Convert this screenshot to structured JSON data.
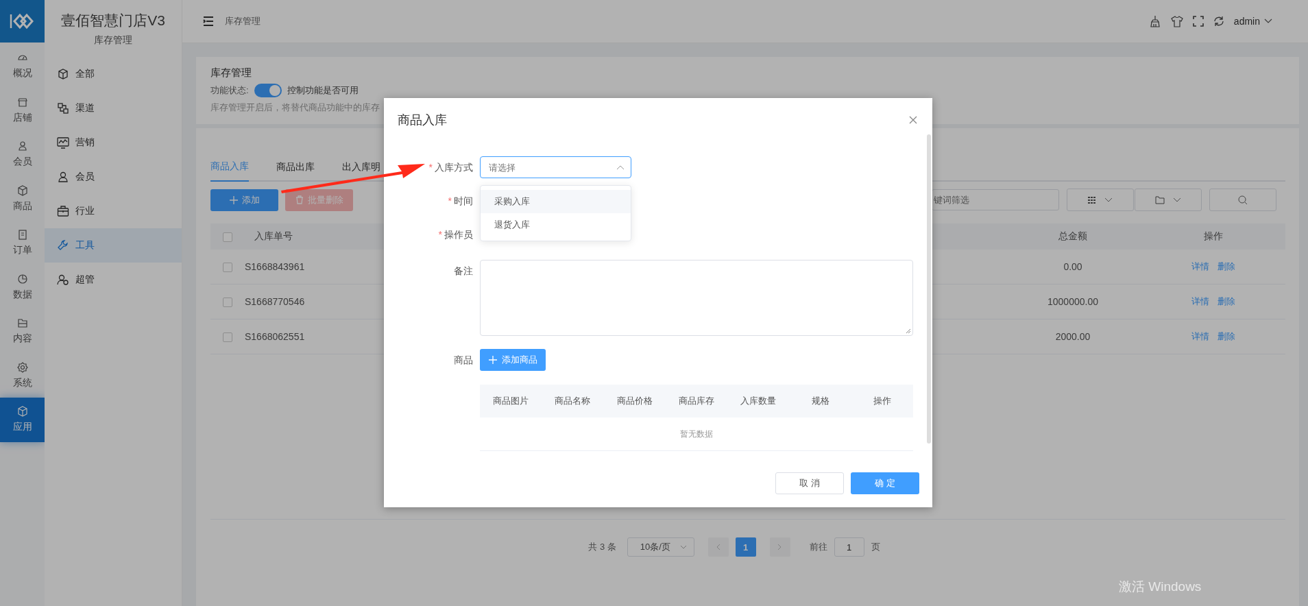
{
  "rail": {
    "items": [
      {
        "label": "概况",
        "selected": false
      },
      {
        "label": "店铺",
        "selected": false
      },
      {
        "label": "会员",
        "selected": false
      },
      {
        "label": "商品",
        "selected": false
      },
      {
        "label": "订单",
        "selected": false
      },
      {
        "label": "数据",
        "selected": false
      },
      {
        "label": "内容",
        "selected": false
      },
      {
        "label": "系统",
        "selected": false
      },
      {
        "label": "应用",
        "selected": true
      }
    ]
  },
  "brand": {
    "title": "壹佰智慧门店V3",
    "subtitle": "库存管理"
  },
  "menu": [
    {
      "label": "全部",
      "selected": false
    },
    {
      "label": "渠道",
      "selected": false
    },
    {
      "label": "营销",
      "selected": false
    },
    {
      "label": "会员",
      "selected": false
    },
    {
      "label": "行业",
      "selected": false
    },
    {
      "label": "工具",
      "selected": true
    },
    {
      "label": "超管",
      "selected": false
    }
  ],
  "header": {
    "breadcrumb": "库存管理",
    "user": "admin"
  },
  "settings_card": {
    "title": "库存管理",
    "switch_label": "功能状态:",
    "switch_on": true,
    "switch_hint": "控制功能是否可用",
    "description": "库存管理开启后，将替代商品功能中的库存"
  },
  "tabs": [
    {
      "label": "商品入库",
      "selected": true
    },
    {
      "label": "商品出库",
      "selected": false
    },
    {
      "label": "出入库明",
      "selected": false
    }
  ],
  "actions": {
    "add": "添加",
    "batch_delete": "批量删除"
  },
  "filter": {
    "placeholder": "键词筛选"
  },
  "table": {
    "header_checked": false,
    "columns": [
      "入库单号",
      "总金额",
      "操作"
    ],
    "rows": [
      {
        "checked": false,
        "id": "S1668843961",
        "total": "0.00",
        "links": [
          "详情",
          "删除"
        ]
      },
      {
        "checked": false,
        "id": "S1668770546",
        "total": "1000000.00",
        "links": [
          "详情",
          "删除"
        ]
      },
      {
        "checked": false,
        "id": "S1668062551",
        "total": "2000.00",
        "links": [
          "详情",
          "删除"
        ]
      }
    ]
  },
  "pagination": {
    "total": "共 3 条",
    "page_size": "10条/页",
    "pages": [
      {
        "label": "1",
        "selected": true
      }
    ],
    "goto_label": "前往",
    "goto_value": "1",
    "goto_suffix": "页"
  },
  "os_notice": "激活 Windows",
  "dialog": {
    "title": "商品入库",
    "required_mark": "*",
    "fields": [
      {
        "kind": "select",
        "label": "入库方式",
        "required": true,
        "placeholder": "请选择",
        "expanded": true,
        "options": [
          {
            "label": "采购入库",
            "highlighted": true
          },
          {
            "label": "退货入库",
            "highlighted": false
          }
        ]
      },
      {
        "kind": "blank",
        "label": "时间",
        "required": true
      },
      {
        "kind": "blank",
        "label": "操作员",
        "required": true
      },
      {
        "kind": "textarea",
        "label": "备注",
        "required": false
      },
      {
        "kind": "button",
        "label": "商品",
        "required": false,
        "button": "添加商品"
      }
    ],
    "goods_table": {
      "columns": [
        "商品图片",
        "商品名称",
        "商品价格",
        "商品库存",
        "入库数量",
        "规格",
        "操作"
      ],
      "empty_text": "暂无数据"
    },
    "cancel": "取 消",
    "confirm": "确 定"
  }
}
